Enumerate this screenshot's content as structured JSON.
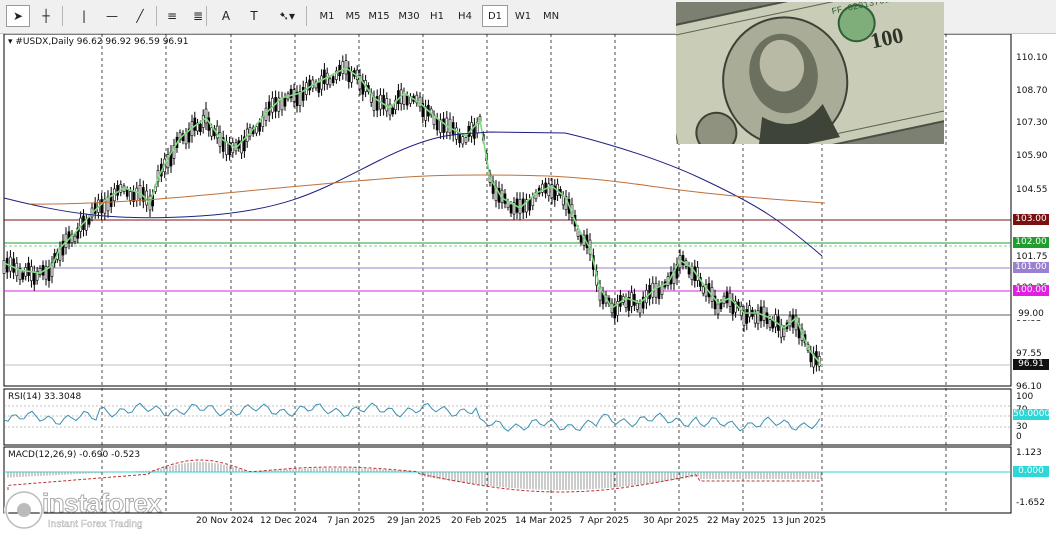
{
  "toolbar": {
    "tools": [
      {
        "name": "cursor-tool",
        "glyph": "➤"
      },
      {
        "name": "crosshair-tool",
        "glyph": "┼"
      },
      {
        "name": "vertical-line-tool",
        "glyph": "|"
      },
      {
        "name": "horizontal-line-tool",
        "glyph": "—"
      },
      {
        "name": "trendline-tool",
        "glyph": "╱"
      },
      {
        "name": "channel-tool",
        "glyph": "≡"
      },
      {
        "name": "fibonacci-tool",
        "glyph": "≣"
      },
      {
        "name": "text-tool",
        "glyph": "A"
      },
      {
        "name": "text-label-tool",
        "glyph": "T"
      },
      {
        "name": "arrows-tool",
        "glyph": "➷▾"
      }
    ],
    "timeframes": [
      "M1",
      "M5",
      "M15",
      "M30",
      "H1",
      "H4",
      "D1",
      "W1",
      "MN"
    ],
    "active_timeframe": "D1"
  },
  "main_pane": {
    "title": "▾ #USDX,Daily  96.62 96.92 96.59 96.91",
    "price_labels": [
      "110.10",
      "108.70",
      "107.30",
      "105.90",
      "104.55",
      "103.15",
      "101.75",
      "100.35",
      "98.95",
      "97.55",
      "96.10"
    ],
    "levels": [
      {
        "value": "103.00",
        "color": "#7a1010"
      },
      {
        "value": "102.00",
        "color": "#1f9e2e"
      },
      {
        "value": "101.00",
        "color": "#9a80d0"
      },
      {
        "value": "100.00",
        "color": "#e020e0"
      },
      {
        "value": "99.00",
        "color": "#606060"
      }
    ],
    "current_price": "96.91"
  },
  "rsi_pane": {
    "title": "RSI(14) 33.3048",
    "labels": [
      "100",
      "70",
      "50.0000",
      "30",
      "0"
    ]
  },
  "macd_pane": {
    "title": "MACD(12,26,9) -0.690 -0.523",
    "labels": [
      "1.123",
      "0.000",
      "-1.652"
    ]
  },
  "x_axis": [
    "20 Nov 2024",
    "12 Dec 2024",
    "7 Jan 2025",
    "29 Jan 2025",
    "20 Feb 2025",
    "14 Mar 2025",
    "7 Apr 2025",
    "30 Apr 2025",
    "22 May 2025",
    "13 Jun 2025"
  ],
  "watermark": {
    "brand": "instaforex",
    "tagline": "Instant Forex Trading"
  },
  "photo_caption": "FF 62013702 A",
  "colors": {
    "ma_fast": "#7fdc7f",
    "ma_mid": "#1f1f80",
    "ma_slow": "#c0703a",
    "rsi": "#3a8fb0",
    "macd": "#c03030"
  }
}
